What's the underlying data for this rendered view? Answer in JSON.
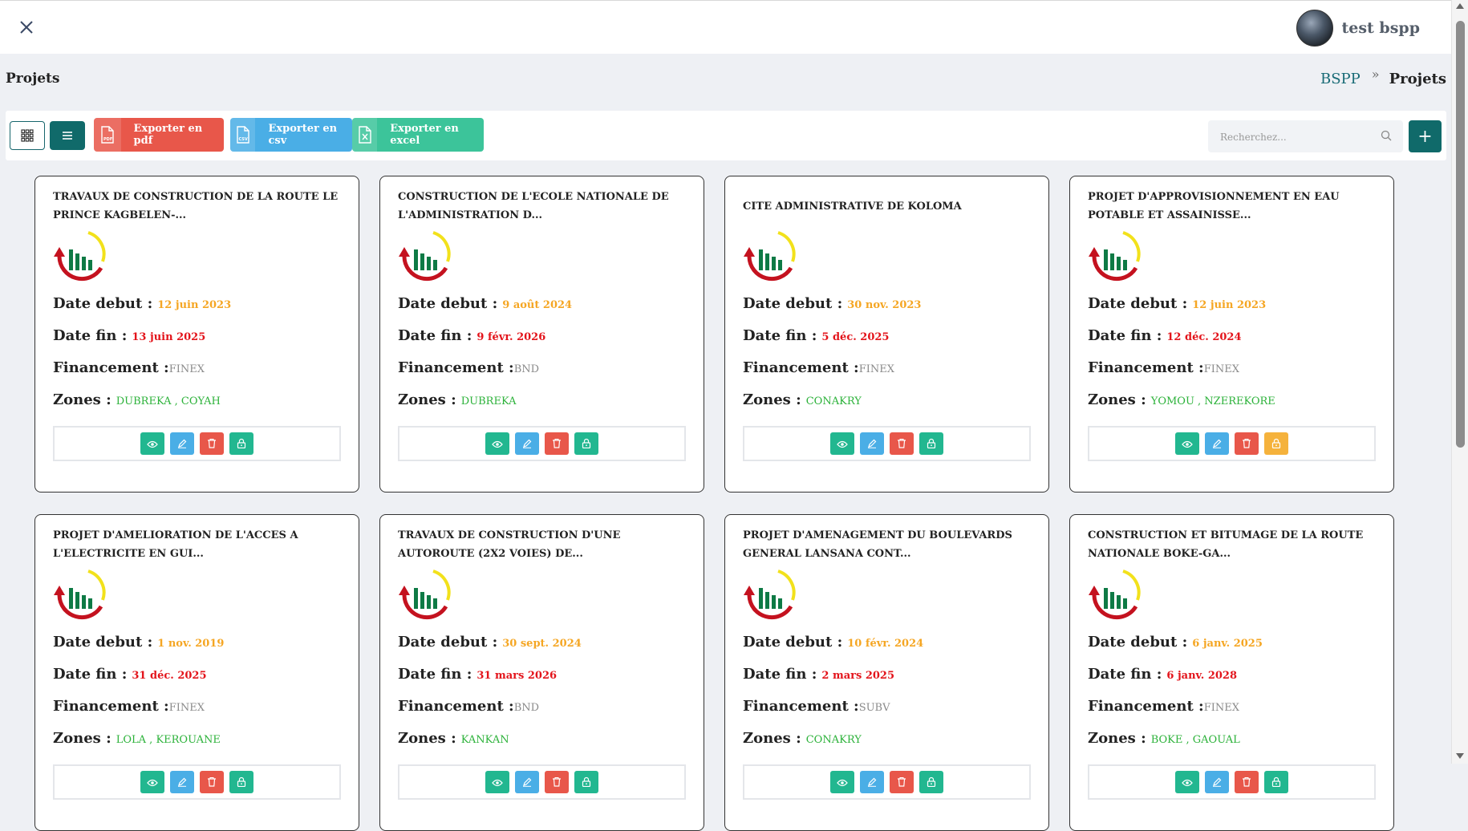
{
  "header": {
    "username": "test bspp"
  },
  "page": {
    "title": "Projets"
  },
  "breadcrumb": {
    "root": "BSPP",
    "current": "Projets"
  },
  "toolbar": {
    "export_pdf": "Exporter en pdf",
    "export_csv": "Exporter en csv",
    "export_excel": "Exporter en excel",
    "search_placeholder": "Recherchez...",
    "add_label": "+"
  },
  "labels": {
    "date_debut": "Date debut :",
    "date_fin": "Date fin :",
    "financement": "Financement :",
    "zones": "Zones :"
  },
  "colors": {
    "primary": "#106a6a",
    "pdf": "#e8574a",
    "csv": "#4aaee6",
    "excel": "#3cc49a",
    "start_date": "#f5a623",
    "end_date": "#e3141b",
    "zones": "#2cb23a"
  },
  "projects": [
    {
      "title": "TRAVAUX DE CONSTRUCTION DE LA ROUTE LE PRINCE KAGBELEN-...",
      "date_debut": "12 juin 2023",
      "date_fin": "13 juin 2025",
      "financement": "FINEX",
      "zones": "DUBREKA , COYAH",
      "lock_state": "normal"
    },
    {
      "title": "CONSTRUCTION DE L'ECOLE NATIONALE DE L'ADMINISTRATION D...",
      "date_debut": "9 août 2024",
      "date_fin": "9 févr. 2026",
      "financement": "BND",
      "zones": "DUBREKA",
      "lock_state": "normal"
    },
    {
      "title": "CITE ADMINISTRATIVE DE KOLOMA",
      "date_debut": "30 nov. 2023",
      "date_fin": "5 déc. 2025",
      "financement": "FINEX",
      "zones": "CONAKRY",
      "lock_state": "normal"
    },
    {
      "title": "PROJET D'APPROVISIONNEMENT EN EAU POTABLE ET ASSAINISSE...",
      "date_debut": "12 juin 2023",
      "date_fin": "12 déc. 2024",
      "financement": "FINEX",
      "zones": "YOMOU , NZEREKORE",
      "lock_state": "warning"
    },
    {
      "title": "PROJET D'AMELIORATION DE L'ACCES A L'ELECTRICITE EN GUI...",
      "date_debut": "1 nov. 2019",
      "date_fin": "31 déc. 2025",
      "financement": "FINEX",
      "zones": "LOLA , KEROUANE",
      "lock_state": "normal"
    },
    {
      "title": "TRAVAUX DE CONSTRUCTION D'UNE AUTOROUTE (2X2 VOIES) DE...",
      "date_debut": "30 sept. 2024",
      "date_fin": "31 mars 2026",
      "financement": "BND",
      "zones": "KANKAN",
      "lock_state": "normal"
    },
    {
      "title": "PROJET D'AMENAGEMENT DU BOULEVARDS GENERAL LANSANA CONT...",
      "date_debut": "10 févr. 2024",
      "date_fin": "2 mars 2025",
      "financement": "SUBV",
      "zones": "CONAKRY",
      "lock_state": "normal"
    },
    {
      "title": "CONSTRUCTION ET BITUMAGE DE LA ROUTE NATIONALE BOKE-GA...",
      "date_debut": "6 janv. 2025",
      "date_fin": "6 janv. 2028",
      "financement": "FINEX",
      "zones": "BOKE , GAOUAL",
      "lock_state": "normal"
    }
  ]
}
